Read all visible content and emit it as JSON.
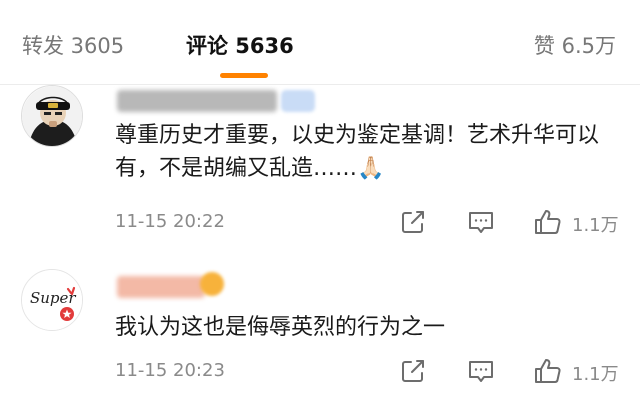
{
  "tabs": {
    "repost": "转发 3605",
    "comments": "评论 5636",
    "likes": "赞 6.5万"
  },
  "comments": [
    {
      "text": "尊重历史才重要，以史为鉴定基调！艺术升华可以有，不是胡编又乱造……🙏🏻",
      "time": "11-15 20:22",
      "likes": "1.1万"
    },
    {
      "avatar_text": "Super",
      "text": "我认为这也是侮辱英烈的行为之一",
      "time": "11-15 20:23",
      "likes": "1.1万"
    }
  ],
  "colors": {
    "accent": "#ff8200",
    "muted": "#8a8a8a"
  }
}
